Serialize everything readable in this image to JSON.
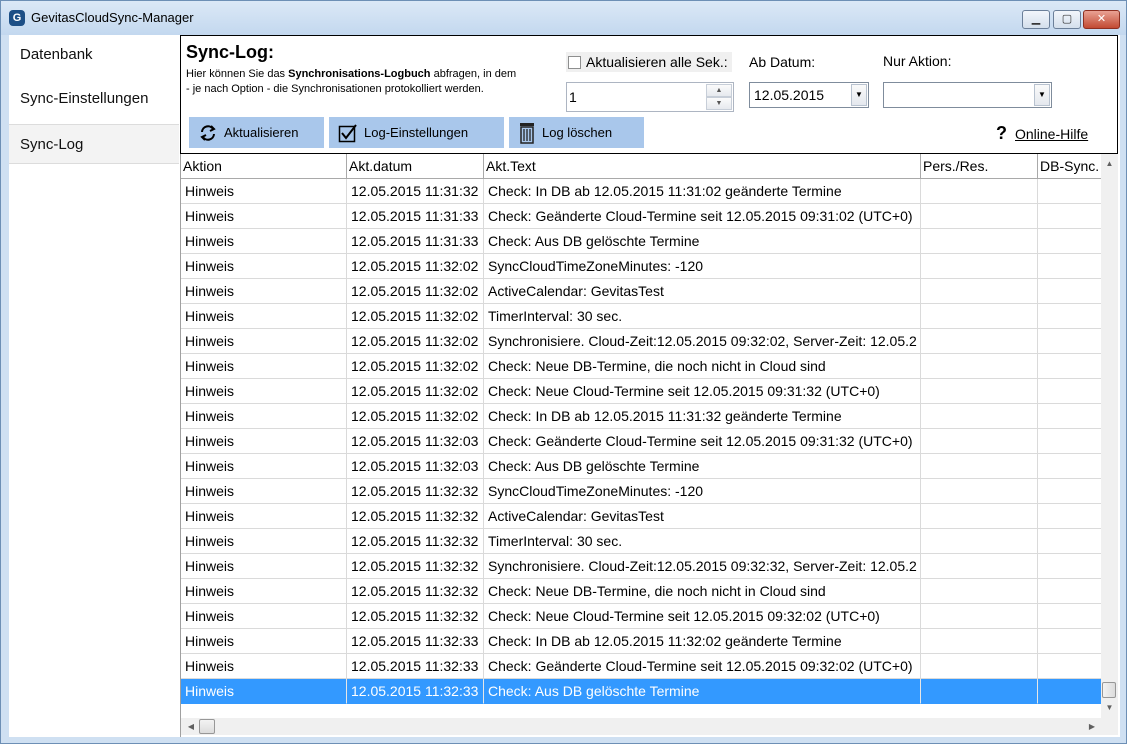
{
  "window": {
    "title": "GevitasCloudSync-Manager",
    "min_glyph": "▁",
    "max_glyph": "▢",
    "close_glyph": "✕"
  },
  "nav": {
    "items": [
      {
        "label": "Datenbank"
      },
      {
        "label": "Sync-Einstellungen"
      },
      {
        "label": "Sync-Log",
        "active": true
      }
    ]
  },
  "header": {
    "title": "Sync-Log:",
    "desc_pre": "Hier können Sie das ",
    "desc_bold": "Synchronisations-Logbuch",
    "desc_post": " abfragen, in dem - je nach Option - die Synchronisationen protokolliert werden.",
    "refresh_checkbox_label": "Aktualisieren alle Sek.:",
    "refresh_checked": false,
    "seconds_value": "1",
    "ab_datum_label": "Ab Datum:",
    "ab_datum_value": "12.05.2015",
    "nur_aktion_label": "Nur Aktion:",
    "nur_aktion_value": ""
  },
  "toolbar": {
    "aktualisieren": "Aktualisieren",
    "log_einstellungen": "Log-Einstellungen",
    "log_loeschen": "Log löschen",
    "help_glyph": "?",
    "online_hilfe": "Online-Hilfe"
  },
  "grid": {
    "columns": [
      "Aktion",
      "Akt.datum",
      "Akt.Text",
      "Pers./Res.",
      "DB-Sync."
    ],
    "rows": [
      [
        "Hinweis",
        "12.05.2015 11:31:32",
        "Check: In DB ab 12.05.2015 11:31:02 geänderte Termine",
        "",
        ""
      ],
      [
        "Hinweis",
        "12.05.2015 11:31:33",
        "Check: Geänderte Cloud-Termine seit 12.05.2015 09:31:02 (UTC+0)",
        "",
        ""
      ],
      [
        "Hinweis",
        "12.05.2015 11:31:33",
        "Check: Aus DB gelöschte Termine",
        "",
        ""
      ],
      [
        "Hinweis",
        "12.05.2015 11:32:02",
        "SyncCloudTimeZoneMinutes: -120",
        "",
        ""
      ],
      [
        "Hinweis",
        "12.05.2015 11:32:02",
        "ActiveCalendar: GevitasTest",
        "",
        ""
      ],
      [
        "Hinweis",
        "12.05.2015 11:32:02",
        "TimerInterval: 30 sec.",
        "",
        ""
      ],
      [
        "Hinweis",
        "12.05.2015 11:32:02",
        "Synchronisiere. Cloud-Zeit:12.05.2015 09:32:02, Server-Zeit: 12.05.2",
        "",
        ""
      ],
      [
        "Hinweis",
        "12.05.2015 11:32:02",
        "Check: Neue DB-Termine, die noch nicht in Cloud sind",
        "",
        ""
      ],
      [
        "Hinweis",
        "12.05.2015 11:32:02",
        "Check: Neue Cloud-Termine seit 12.05.2015 09:31:32 (UTC+0)",
        "",
        ""
      ],
      [
        "Hinweis",
        "12.05.2015 11:32:02",
        "Check: In DB ab 12.05.2015 11:31:32 geänderte Termine",
        "",
        ""
      ],
      [
        "Hinweis",
        "12.05.2015 11:32:03",
        "Check: Geänderte Cloud-Termine seit 12.05.2015 09:31:32 (UTC+0)",
        "",
        ""
      ],
      [
        "Hinweis",
        "12.05.2015 11:32:03",
        "Check: Aus DB gelöschte Termine",
        "",
        ""
      ],
      [
        "Hinweis",
        "12.05.2015 11:32:32",
        "SyncCloudTimeZoneMinutes: -120",
        "",
        ""
      ],
      [
        "Hinweis",
        "12.05.2015 11:32:32",
        "ActiveCalendar: GevitasTest",
        "",
        ""
      ],
      [
        "Hinweis",
        "12.05.2015 11:32:32",
        "TimerInterval: 30 sec.",
        "",
        ""
      ],
      [
        "Hinweis",
        "12.05.2015 11:32:32",
        "Synchronisiere. Cloud-Zeit:12.05.2015 09:32:32, Server-Zeit: 12.05.2",
        "",
        ""
      ],
      [
        "Hinweis",
        "12.05.2015 11:32:32",
        "Check: Neue DB-Termine, die noch nicht in Cloud sind",
        "",
        ""
      ],
      [
        "Hinweis",
        "12.05.2015 11:32:32",
        "Check: Neue Cloud-Termine seit 12.05.2015 09:32:02 (UTC+0)",
        "",
        ""
      ],
      [
        "Hinweis",
        "12.05.2015 11:32:33",
        "Check: In DB ab 12.05.2015 11:32:02 geänderte Termine",
        "",
        ""
      ],
      [
        "Hinweis",
        "12.05.2015 11:32:33",
        "Check: Geänderte Cloud-Termine seit 12.05.2015 09:32:02 (UTC+0)",
        "",
        ""
      ],
      [
        "Hinweis",
        "12.05.2015 11:32:33",
        "Check: Aus DB gelöschte Termine",
        "",
        ""
      ]
    ],
    "selected_row": 20
  },
  "colors": {
    "selection": "#3399ff",
    "toolbar_button": "#a9c7eb",
    "window_frame": "#cfe0f2"
  }
}
